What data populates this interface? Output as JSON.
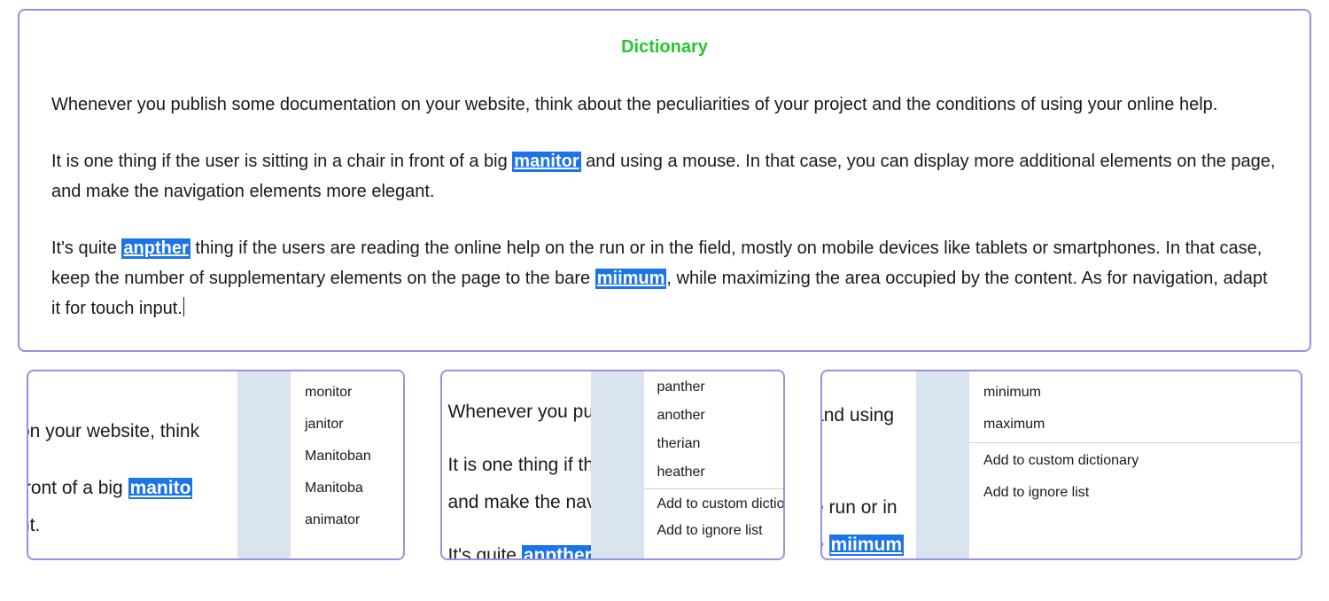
{
  "main": {
    "title": "Dictionary",
    "para1": "Whenever you publish some documentation on your website, think about the peculiarities of your project and the conditions of using your online help.",
    "para2_a": "It is one thing if the user is sitting in a chair in front of a big ",
    "para2_mis": "manitor",
    "para2_b": " and using a mouse. In that case, you can display more additional elements on the page, and make the navigation elements more elegant.",
    "para3_a": "It's quite ",
    "para3_mis1": "anpther",
    "para3_b": " thing if the users are reading the online help on the run or in the field, mostly on mobile devices like tablets or smartphones. In that case, keep the number of supplementary elements on the page to the bare ",
    "para3_mis2": "miimum",
    "para3_c": ", while maximizing the area occupied by the content. As for navigation, adapt it for touch input."
  },
  "popup1": {
    "under_line1": "on your website, think",
    "under_line2a": "front of a big ",
    "under_line2_mis": "manito",
    "under_line3": "nt.",
    "suggestions": [
      "monitor",
      "janitor",
      "Manitoban",
      "Manitoba",
      "animator"
    ]
  },
  "popup2": {
    "under_line1": "Whenever you pul",
    "under_line2": "It is one thing if th",
    "under_line3": "and make the navi",
    "under_line4a": "It's quite ",
    "under_line4_mis": "anpther",
    "suggestions": [
      "panther",
      "another",
      "therian",
      "heather"
    ],
    "actions": [
      "Add to custom dictionary",
      "Add to ignore list"
    ]
  },
  "popup3": {
    "under_line1": "and using",
    "under_line2": "e run or in",
    "under_line3a": "e ",
    "under_line3_mis": "miimum",
    "suggestions": [
      "minimum",
      "maximum"
    ],
    "actions": [
      "Add to custom dictionary",
      "Add to ignore list"
    ]
  }
}
